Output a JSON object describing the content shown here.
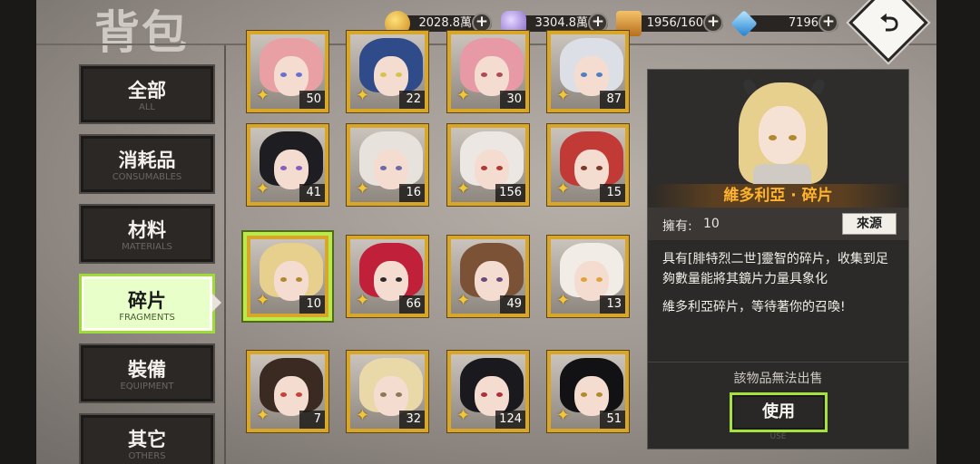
{
  "header": {
    "title": "背包"
  },
  "resources": [
    {
      "name": "gold",
      "icon": "gold-coin-icon",
      "value": "2028.8萬",
      "color": "#e3a51f"
    },
    {
      "name": "crystal",
      "icon": "purple-crystal-icon",
      "value": "3304.8萬",
      "color": "#b79ae8"
    },
    {
      "name": "bag",
      "icon": "box-icon",
      "value": "1956/160",
      "color": "#e7a33b"
    },
    {
      "name": "diamond",
      "icon": "diamond-icon",
      "value": "7196",
      "color": "#3aa8f0"
    }
  ],
  "back": {
    "glyph": "⮌"
  },
  "categories": [
    {
      "cn": "全部",
      "en": "ALL"
    },
    {
      "cn": "消耗品",
      "en": "CONSUMABLES"
    },
    {
      "cn": "材料",
      "en": "MATERIALS"
    },
    {
      "cn": "碎片",
      "en": "FRAGMENTS",
      "active": true
    },
    {
      "cn": "裝備",
      "en": "EQUIPMENT"
    },
    {
      "cn": "其它",
      "en": "OTHERS"
    }
  ],
  "items": [
    {
      "count": "50",
      "hair": "#e8a0a4",
      "eye": "#6b6fd0"
    },
    {
      "count": "22",
      "hair": "#2f4b8a",
      "eye": "#d4c44a"
    },
    {
      "count": "30",
      "hair": "#e79aa6",
      "eye": "#b04a54"
    },
    {
      "count": "87",
      "hair": "#dcdfe6",
      "eye": "#4e7ec4"
    },
    {
      "count": "41",
      "hair": "#1d1d22",
      "eye": "#8c5bc0"
    },
    {
      "count": "16",
      "hair": "#e8e2dc",
      "eye": "#6a6aa8"
    },
    {
      "count": "156",
      "hair": "#ece7e2",
      "eye": "#b23a34"
    },
    {
      "count": "15",
      "hair": "#c13a36",
      "eye": "#7c3a2a"
    },
    {
      "count": "10",
      "hair": "#e7cf8e",
      "eye": "#b2882d",
      "selected": true
    },
    {
      "count": "66",
      "hair": "#c0203a",
      "eye": "#2b2b2b"
    },
    {
      "count": "49",
      "hair": "#7c5236",
      "eye": "#6a4a7a"
    },
    {
      "count": "13",
      "hair": "#f1ece6",
      "eye": "#e0a23a"
    },
    {
      "count": "7",
      "hair": "#3b2a22",
      "eye": "#c2443a"
    },
    {
      "count": "32",
      "hair": "#e9d8a8",
      "eye": "#8a7a5a"
    },
    {
      "count": "124",
      "hair": "#1a1a1e",
      "eye": "#b0303a"
    },
    {
      "count": "51",
      "hair": "#121214",
      "eye": "#b28a2a"
    }
  ],
  "detail": {
    "name": "維多利亞 · 碎片",
    "own_label": "擁有:",
    "own_value": "10",
    "source_button": "來源",
    "desc_1": "具有[腓特烈二世]靈智的碎片，收集到足夠數量能將其鏡片力量具象化",
    "desc_2": "維多利亞碎片，等待著你的召喚!",
    "no_sell": "該物品無法出售",
    "use_button": "使用",
    "use_en": "USE"
  }
}
